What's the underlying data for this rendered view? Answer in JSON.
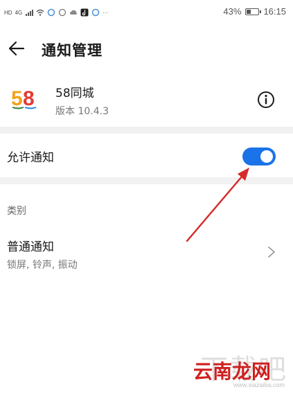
{
  "status_bar": {
    "left_badge": "HD",
    "network": "4G",
    "battery_text": "43%",
    "battery_level": 0.43,
    "time": "16:15"
  },
  "header": {
    "title": "通知管理",
    "back_icon": "arrow-left-icon"
  },
  "app": {
    "name": "58同城",
    "version": "版本 10.4.3",
    "logo_text": "58",
    "info_icon": "info-icon"
  },
  "allow_notifications": {
    "label": "允许通知",
    "enabled": true,
    "toggle_color": "#1a73e8"
  },
  "category": {
    "header": "类别",
    "items": [
      {
        "title": "普通通知",
        "subtitle": "锁屏, 铃声, 振动"
      }
    ]
  },
  "annotation": {
    "arrow_color": "#d62b2b"
  },
  "watermark": {
    "big_text": "下载吧",
    "site_name": "云南龙网",
    "url": "www.xiazaiba.com"
  }
}
